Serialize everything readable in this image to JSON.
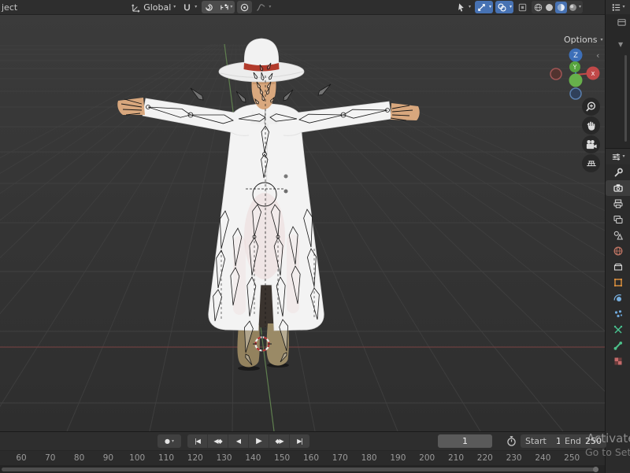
{
  "viewport_header": {
    "mode_truncated": "ject",
    "orientation_label": "Global",
    "options_label": "Options",
    "panel_collapse_glyph": "‹"
  },
  "glyphs": {
    "chevron_down": "▾",
    "record_dot": "●",
    "filter_triangle": "▼"
  },
  "gizmo": {
    "axis_x": "x",
    "axis_y": "Y",
    "axis_z": "Z"
  },
  "colors": {
    "accent_blue": "#4772b3",
    "axis_red": "#c14949",
    "axis_green": "#67b04b",
    "axis_z_blue": "#3d6fb8",
    "hat_band_red": "#b23b2c"
  },
  "properties_tabs": {
    "active": "render-properties-tab",
    "items": [
      "tool",
      "render",
      "output",
      "view-layer",
      "scene",
      "world",
      "collection",
      "object",
      "physics",
      "particles",
      "constraints",
      "object-data",
      "texture"
    ]
  },
  "timeline": {
    "current_frame": "1",
    "start_label": "Start",
    "start_value": "1",
    "end_label": "End",
    "end_value": "250",
    "ruler_ticks": [
      60,
      70,
      80,
      90,
      100,
      110,
      120,
      130,
      140,
      150,
      160,
      170,
      180,
      190,
      200,
      210,
      220,
      230,
      240,
      250
    ],
    "transport": [
      {
        "name": "jump-to-start-button",
        "glyph": "|◀"
      },
      {
        "name": "prev-keyframe-button",
        "glyph": "◀◆"
      },
      {
        "name": "play-reverse-button",
        "glyph": "◀"
      },
      {
        "name": "play-button",
        "glyph": "▶"
      },
      {
        "name": "next-keyframe-button",
        "glyph": "◆▶"
      },
      {
        "name": "jump-to-end-button",
        "glyph": "▶|"
      }
    ]
  },
  "watermark": {
    "line1": "Activate",
    "line2": "Go to Sett"
  }
}
